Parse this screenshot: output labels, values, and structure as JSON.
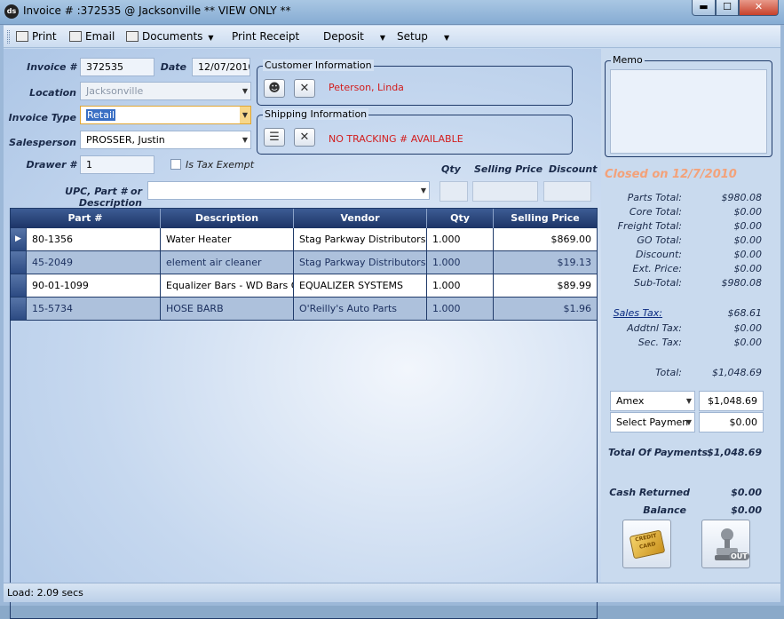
{
  "window": {
    "title": "Invoice # :372535 @ Jacksonville ** VIEW ONLY **",
    "app_icon_text": "ds",
    "min": "▬",
    "max": "☐",
    "close": "✕"
  },
  "toolbar": {
    "print": "Print",
    "email": "Email",
    "documents": "Documents",
    "print_receipt": "Print Receipt",
    "deposit": "Deposit",
    "setup": "Setup"
  },
  "form": {
    "invoice_label": "Invoice #",
    "invoice_value": "372535",
    "date_label": "Date",
    "date_value": "12/07/2010",
    "location_label": "Location",
    "location_value": "Jacksonville",
    "invoice_type_label": "Invoice Type",
    "invoice_type_value": "Retail",
    "salesperson_label": "Salesperson",
    "salesperson_value": "PROSSER, Justin",
    "drawer_label": "Drawer #",
    "drawer_value": "1",
    "tax_exempt_label": "Is Tax Exempt",
    "upc_label": "UPC, Part # or Description",
    "upc_value": "",
    "qty_label": "Qty",
    "selling_price_label": "Selling Price",
    "discount_label": "Discount"
  },
  "customer": {
    "title": "Customer Information",
    "name": "Peterson, Linda"
  },
  "shipping": {
    "title": "Shipping Information",
    "tracking": "NO TRACKING # AVAILABLE"
  },
  "grid": {
    "headers": [
      "Part #",
      "Description",
      "Vendor",
      "Qty",
      "Selling Price"
    ],
    "rows": [
      {
        "part": "80-1356",
        "desc": "Water Heater",
        "vendor": "Stag Parkway Distributors",
        "qty": "1.000",
        "price": "$869.00"
      },
      {
        "part": "45-2049",
        "desc": "element air cleaner",
        "vendor": "Stag Parkway Distributors",
        "qty": "1.000",
        "price": "$19.13"
      },
      {
        "part": "90-01-1099",
        "desc": "Equalizer Bars - WD Bars O",
        "vendor": "EQUALIZER SYSTEMS",
        "qty": "1.000",
        "price": "$89.99"
      },
      {
        "part": "15-5734",
        "desc": "HOSE BARB",
        "vendor": "O'Reilly's Auto Parts",
        "qty": "1.000",
        "price": "$1.96"
      }
    ]
  },
  "memo": {
    "title": "Memo",
    "value": ""
  },
  "summary": {
    "closed": "Closed on 12/7/2010",
    "parts_total_label": "Parts Total:",
    "parts_total": "$980.08",
    "core_total_label": "Core Total:",
    "core_total": "$0.00",
    "freight_total_label": "Freight Total:",
    "freight_total": "$0.00",
    "go_total_label": "GO Total:",
    "go_total": "$0.00",
    "discount_label": "Discount:",
    "discount": "$0.00",
    "ext_price_label": "Ext. Price:",
    "ext_price": "$0.00",
    "subtotal_label": "Sub-Total:",
    "subtotal": "$980.08",
    "sales_tax_label": "Sales Tax:",
    "sales_tax": "$68.61",
    "addtnl_tax_label": "Addtnl Tax:",
    "addtnl_tax": "$0.00",
    "sec_tax_label": "Sec. Tax:",
    "sec_tax": "$0.00",
    "total_label": "Total:",
    "total": "$1,048.69",
    "payment1_method": "Amex",
    "payment1_amount": "$1,048.69",
    "payment2_method": "Select Paymen",
    "payment2_amount": "$0.00",
    "total_payments_label": "Total Of Payments",
    "total_payments": "$1,048.69",
    "cash_returned_label": "Cash Returned",
    "cash_returned": "$0.00",
    "balance_label": "Balance",
    "balance": "$0.00",
    "card_text": "CREDIT CARD",
    "stamp_text": "OUT"
  },
  "status": {
    "text": "Load: 2.09 secs"
  }
}
